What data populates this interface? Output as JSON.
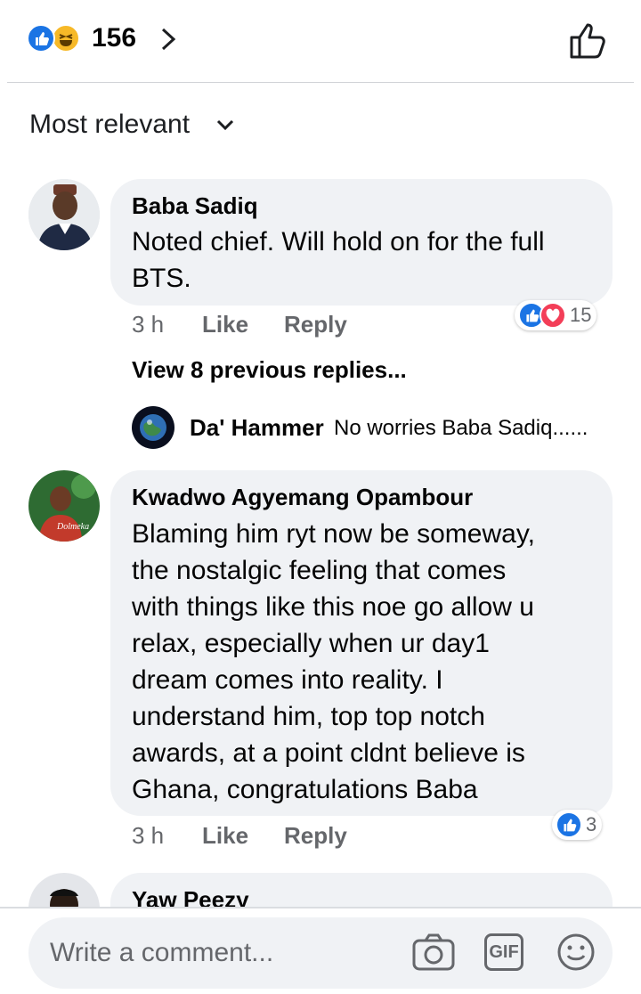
{
  "header": {
    "reaction_count": "156",
    "reactions": [
      "like-icon",
      "haha-icon"
    ]
  },
  "sort": {
    "label": "Most relevant"
  },
  "comments": [
    {
      "author": "Baba Sadiq",
      "text_lines": [
        "Noted chief. Will hold on for the full",
        "BTS."
      ],
      "time": "3 h",
      "like_label": "Like",
      "reply_label": "Reply",
      "reaction_count": "15",
      "reactions": [
        "like-icon",
        "love-icon"
      ],
      "view_previous": "View 8 previous replies...",
      "reply_preview": {
        "author": "Da' Hammer",
        "text": "No worries Baba Sadiq......"
      }
    },
    {
      "author": "Kwadwo Agyemang Opambour",
      "text_lines": [
        "Blaming him ryt now be someway,",
        "the nostalgic feeling that comes",
        "with things like this noe go allow u",
        "relax, especially when ur day1",
        "dream comes into reality. I",
        "understand him, top top notch",
        "awards, at a point cldnt believe is",
        "Ghana, congratulations Baba"
      ],
      "time": "3 h",
      "like_label": "Like",
      "reply_label": "Reply",
      "reaction_count": "3",
      "reactions": [
        "like-icon"
      ]
    },
    {
      "author": "Yaw Peezy"
    }
  ],
  "composer": {
    "placeholder": "Write a comment...",
    "icons": [
      "camera-icon",
      "gif-icon",
      "emoji-icon"
    ],
    "gif_label": "GIF"
  },
  "colors": {
    "brand_blue": "#1b74e4",
    "bubble_bg": "#f0f2f5",
    "meta_gray": "#65676b",
    "love_red": "#f33e58",
    "haha_yellow": "#f7b928"
  }
}
